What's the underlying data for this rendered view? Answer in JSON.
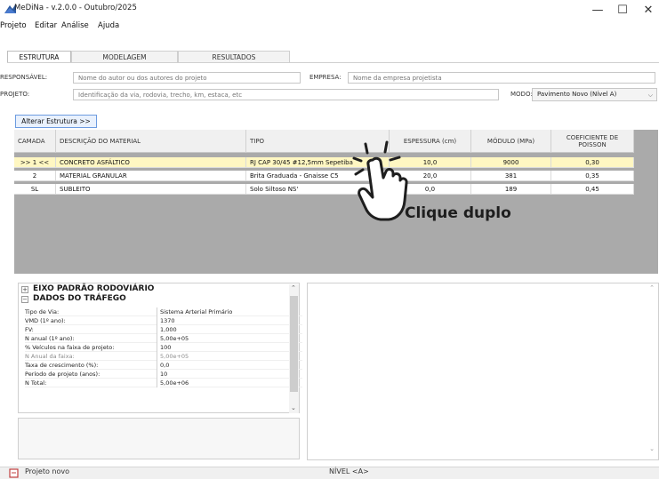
{
  "window": {
    "title": "MeDiNa - v.2.0.0 - Outubro/2025",
    "minimize_glyph": "—",
    "maximize_glyph": "☐",
    "close_glyph": "✕"
  },
  "menu": {
    "items": [
      "Projeto",
      "Editar",
      "Análise",
      "Ajuda"
    ]
  },
  "tabs": [
    {
      "label": "ESTRUTURA",
      "active": true
    },
    {
      "label": "MODELAGEM",
      "active": false
    },
    {
      "label": "RESULTADOS",
      "active": false
    }
  ],
  "form": {
    "responsavel_label": "RESPONSÁVEL:",
    "responsavel_placeholder": "Nome do autor ou dos autores do projeto",
    "empresa_label": "EMPRESA:",
    "empresa_placeholder": "Nome da empresa projetista",
    "projeto_label": "PROJETO:",
    "projeto_placeholder": "Identificação da via, rodovia, trecho, km, estaca, etc",
    "modo_label": "MODO:",
    "modo_value": "Pavimento Novo (Nível A)"
  },
  "alter_button": "Alterar Estrutura >>",
  "layers_table": {
    "headers": {
      "camada": "CAMADA",
      "descricao": "DESCRIÇÃO DO MATERIAL",
      "tipo": "TIPO",
      "espessura": "ESPESSURA (cm)",
      "modulo": "MÓDULO (MPa)",
      "poisson": "COEFICIENTE DE POISSON"
    },
    "rows": [
      {
        "camada": ">> 1 <<",
        "descricao": "CONCRETO ASFÁLTICO",
        "tipo": "RJ CAP 30/45 #12,5mm Sepetiba",
        "espessura": "10,0",
        "modulo": "9000",
        "poisson": "0,30",
        "selected": true
      },
      {
        "camada": "2",
        "descricao": "MATERIAL GRANULAR",
        "tipo": "Brita Graduada - Gnaisse C5",
        "espessura": "20,0",
        "modulo": "381",
        "poisson": "0,35",
        "selected": false
      },
      {
        "camada": "SL",
        "descricao": "SUBLEITO",
        "tipo": "Solo Siltoso NS'",
        "espessura": "0,0",
        "modulo": "189",
        "poisson": "0,45",
        "selected": false
      }
    ]
  },
  "annotation": {
    "text": "Clique duplo",
    "icon": "double-click-hand-icon"
  },
  "properties": {
    "section1": "EIXO PADRÃO RODOVIÁRIO",
    "section2": "DADOS DO TRÁFEGO",
    "rows": [
      {
        "name": "Tipo de Via:",
        "value": "Sistema Arterial Primário",
        "dim": false
      },
      {
        "name": "VMD (1º ano):",
        "value": "1370",
        "dim": false
      },
      {
        "name": "FV:",
        "value": "1,000",
        "dim": false
      },
      {
        "name": "N anual (1º ano):",
        "value": "5,00e+05",
        "dim": false
      },
      {
        "name": "% Veículos na faixa de projeto:",
        "value": "100",
        "dim": false
      },
      {
        "name": "N Anual da faixa:",
        "value": "5,00e+05",
        "dim": true
      },
      {
        "name": "Taxa de crescimento (%):",
        "value": "0,0",
        "dim": false
      },
      {
        "name": "Período de projeto (anos):",
        "value": "10",
        "dim": false
      },
      {
        "name": "N Total:",
        "value": "5,00e+06",
        "dim": false
      }
    ]
  },
  "status": {
    "left": "Projeto novo",
    "nivel": "NÍVEL <A>"
  },
  "colors": {
    "selected_row": "#fff7c2",
    "grid_background": "#aaaaaa",
    "button_border": "#6c9be0"
  }
}
